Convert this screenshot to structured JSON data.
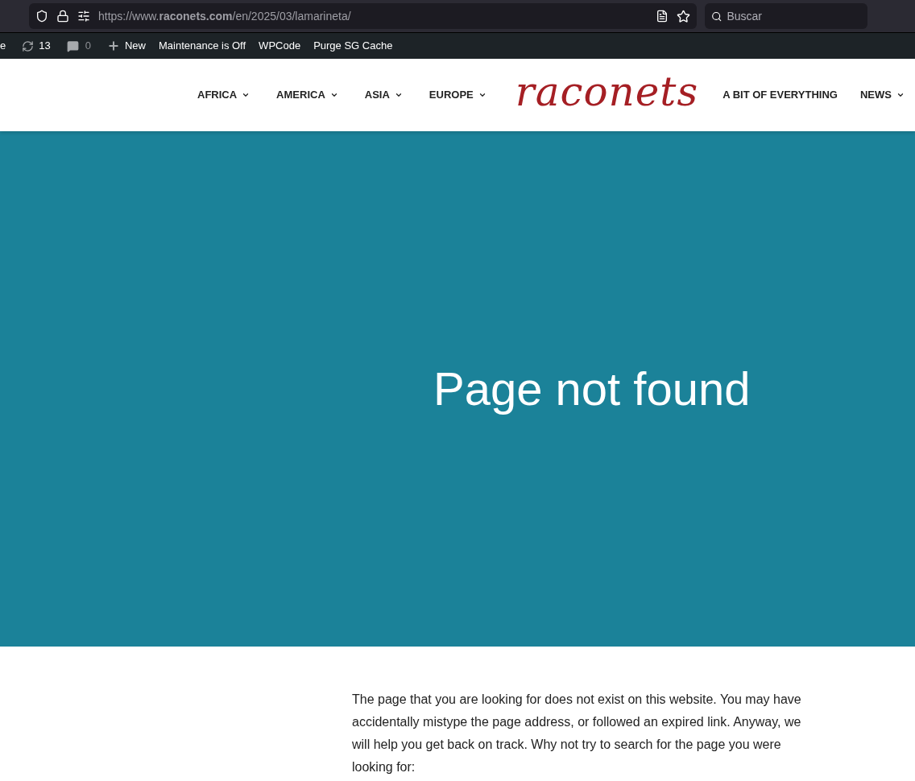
{
  "browser": {
    "url": "https://www.**raconets.com**/en/2025/03/lamarineta/",
    "search": {
      "placeholder": "Buscar"
    }
  },
  "admin_bar": {
    "cut_item": "e",
    "updates_count": "13",
    "comments_count": "0",
    "new_label": "New",
    "items": [
      "Maintenance is Off",
      "WPCode",
      "Purge SG Cache"
    ]
  },
  "nav": {
    "left": [
      {
        "label": "AFRICA",
        "dropdown": true
      },
      {
        "label": "AMERICA",
        "dropdown": true
      },
      {
        "label": "ASIA",
        "dropdown": true
      },
      {
        "label": "EUROPE",
        "dropdown": true
      }
    ],
    "logo": "raconets",
    "right": [
      {
        "label": "A BIT OF EVERYTHING",
        "dropdown": false
      },
      {
        "label": "NEWS",
        "dropdown": true
      }
    ]
  },
  "hero": {
    "title": "Page not found"
  },
  "body": {
    "text": "The page that you are looking for does not exist on this website. You may have accidentally mistype the page address, or followed an expired link. Anyway, we will help you get back on track. Why not try to search for the page you were looking for:"
  }
}
